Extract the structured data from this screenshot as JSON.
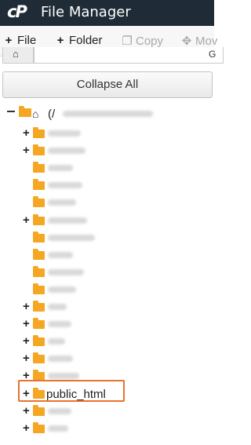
{
  "header": {
    "logo_text": "cP",
    "title": "File Manager"
  },
  "toolbar": {
    "file": {
      "icon": "plus-icon",
      "label": "File"
    },
    "folder": {
      "icon": "plus-icon",
      "label": "Folder"
    },
    "copy": {
      "icon": "copy-icon",
      "label": "Copy"
    },
    "move": {
      "icon": "move-icon",
      "label": "Mov"
    }
  },
  "path_bar": {
    "home_icon": "home-icon",
    "go_text": "G"
  },
  "collapse_all_label": "Collapse All",
  "tree": {
    "root": {
      "prefix": "(/",
      "expanded": true,
      "icon": "home-icon"
    },
    "items": [
      {
        "expandable": true
      },
      {
        "expandable": true
      },
      {
        "expandable": false
      },
      {
        "expandable": false
      },
      {
        "expandable": false
      },
      {
        "expandable": true
      },
      {
        "expandable": false
      },
      {
        "expandable": false
      },
      {
        "expandable": false
      },
      {
        "expandable": false
      },
      {
        "expandable": true
      },
      {
        "expandable": true
      },
      {
        "expandable": true
      },
      {
        "expandable": true
      },
      {
        "expandable": true
      },
      {
        "expandable": true,
        "label": "public_html",
        "highlighted": true
      },
      {
        "expandable": true
      },
      {
        "expandable": true
      }
    ]
  },
  "colors": {
    "titlebar": "#1f2b36",
    "folder": "#f5a623",
    "highlight": "#e8732b"
  }
}
